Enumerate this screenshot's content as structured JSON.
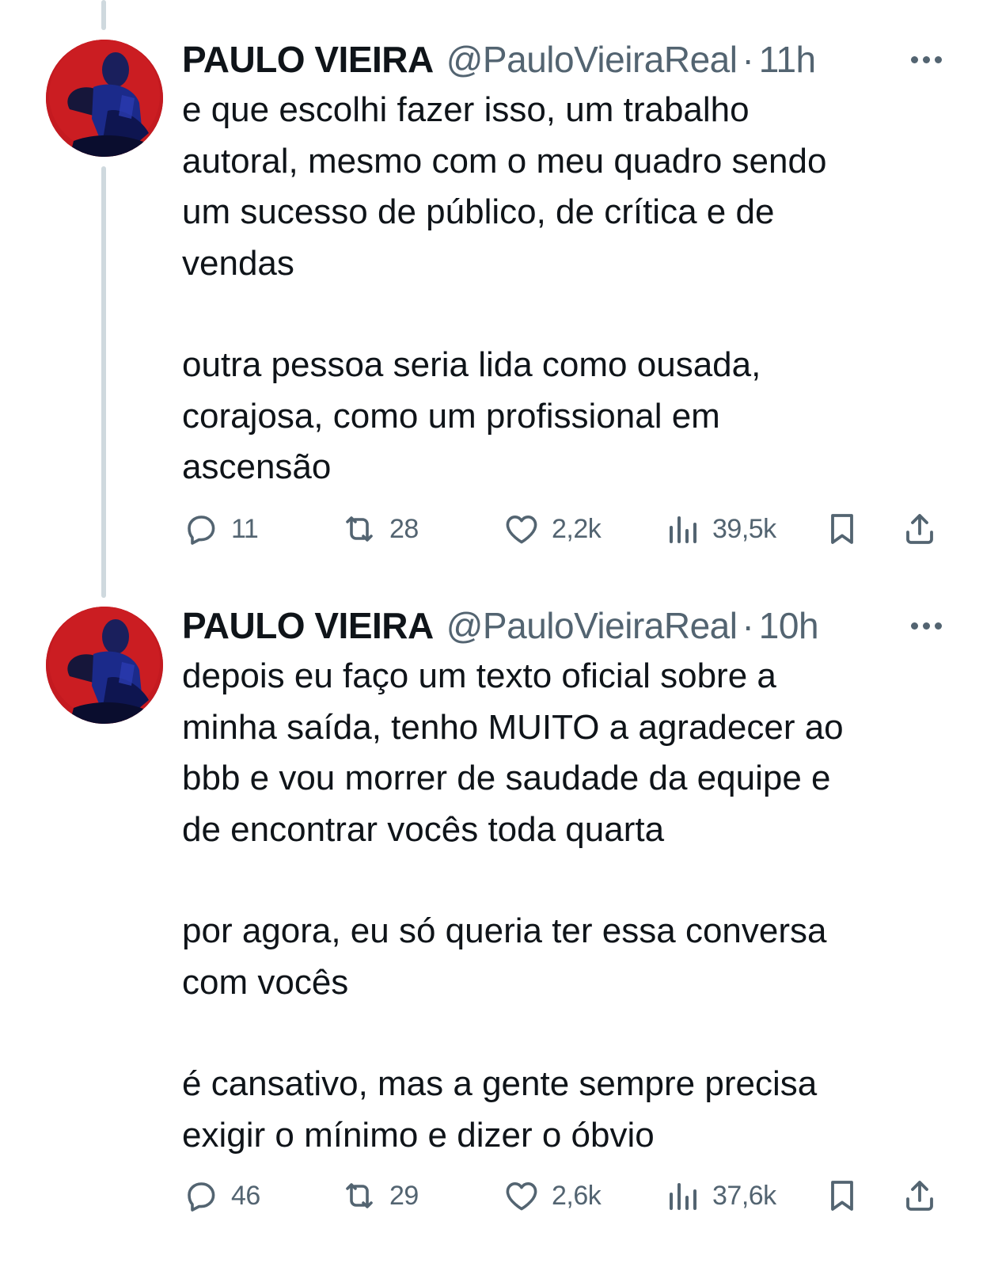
{
  "tweets": [
    {
      "author_name": "PAULO VIEIRA",
      "handle": "@PauloVieiraReal",
      "separator": "·",
      "time": "11h",
      "paragraphs": [
        [
          "e que escolhi fazer isso, um trabalho",
          "autoral, mesmo com o meu quadro sendo",
          "um sucesso de público, de crítica e de",
          "vendas"
        ],
        [
          "outra pessoa seria lida como ousada,",
          "corajosa, como um profissional em",
          "ascensão"
        ]
      ],
      "replies": "11",
      "retweets": "28",
      "likes": "2,2k",
      "views": "39,5k"
    },
    {
      "author_name": "PAULO VIEIRA",
      "handle": "@PauloVieiraReal",
      "separator": "·",
      "time": "10h",
      "paragraphs": [
        [
          "depois eu faço um texto oficial sobre a",
          "minha saída, tenho MUITO a agradecer ao",
          "bbb e vou morrer de saudade da equipe e",
          "de encontrar vocês toda quarta"
        ],
        [
          "por agora, eu só queria ter essa conversa",
          "com vocês"
        ],
        [
          "é cansativo, mas a gente sempre precisa",
          "exigir o mínimo e dizer o óbvio"
        ]
      ],
      "replies": "46",
      "retweets": "29",
      "likes": "2,6k",
      "views": "37,6k"
    }
  ],
  "icons": {
    "reply": "reply-icon",
    "retweet": "retweet-icon",
    "like": "heart-icon",
    "views": "views-icon",
    "bookmark": "bookmark-icon",
    "share": "share-icon",
    "more": "more-icon"
  },
  "colors": {
    "text": "#0f1419",
    "secondary": "#536471",
    "thread_line": "#cfd9de",
    "avatar_bg": "#c41a20"
  }
}
